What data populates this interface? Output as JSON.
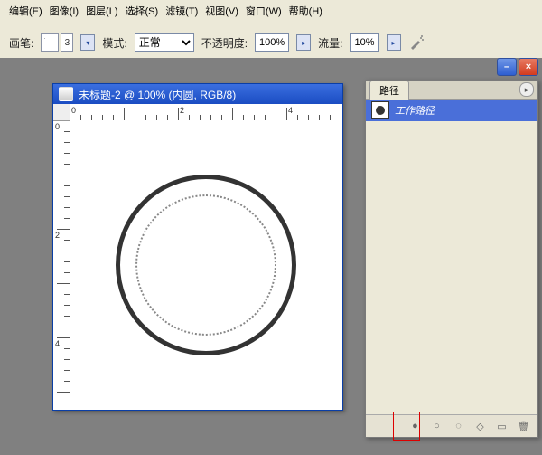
{
  "menu": {
    "edit": "编辑(E)",
    "image": "图像(I)",
    "layer": "图层(L)",
    "select": "选择(S)",
    "filter": "滤镜(T)",
    "view": "视图(V)",
    "window": "窗口(W)",
    "help": "帮助(H)"
  },
  "toolbar": {
    "brush_label": "画笔:",
    "brush_size": "3",
    "mode_label": "模式:",
    "mode_value": "正常",
    "opacity_label": "不透明度:",
    "opacity_value": "100%",
    "flow_label": "流量:",
    "flow_value": "10%"
  },
  "panel_ctrl": {
    "min": "–",
    "close": "×"
  },
  "doc": {
    "title": "未标题-2 @ 100% (内圆, RGB/8)",
    "ruler": {
      "n0": "0",
      "n2": "2",
      "n4": "4"
    }
  },
  "paths_panel": {
    "tab_label": "路径",
    "item_label": "工作路径",
    "footer": {
      "fill": "●",
      "stroke": "○",
      "to_sel": "◌",
      "from_sel": "◇",
      "new": "▭",
      "delete": "🗑"
    }
  }
}
